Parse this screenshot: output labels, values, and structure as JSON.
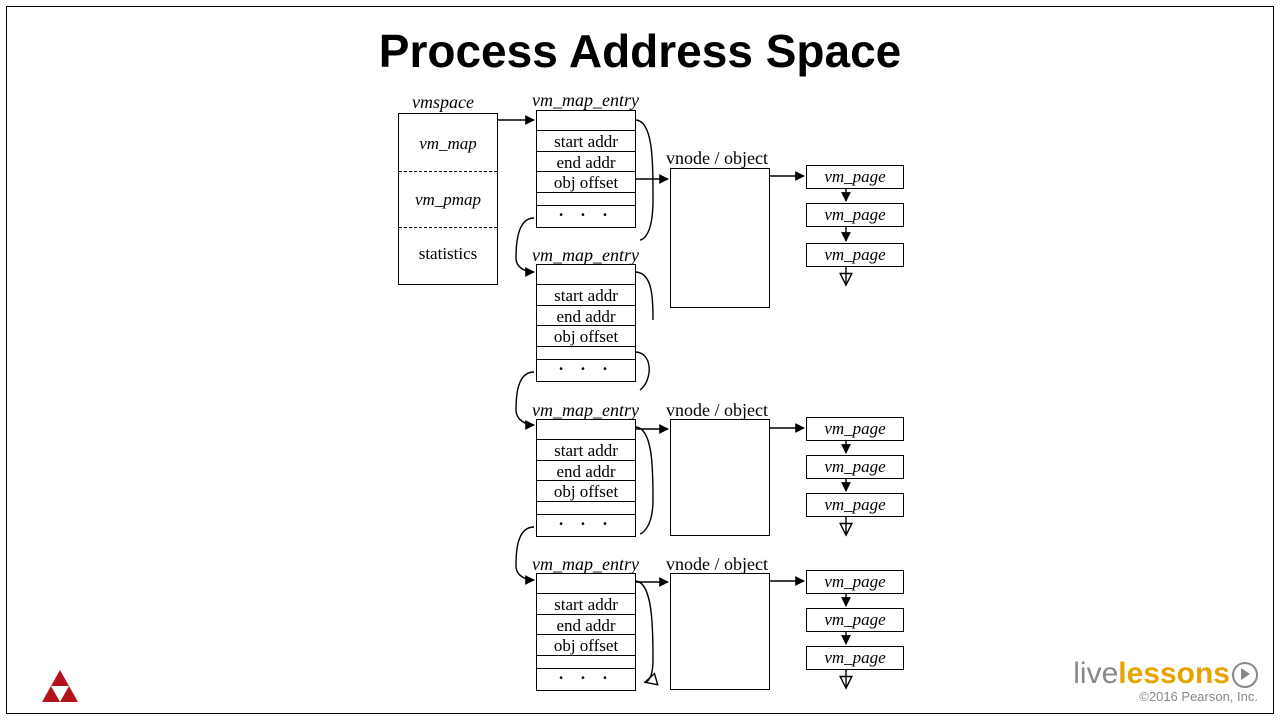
{
  "title": "Process Address Space",
  "vmspace": {
    "label": "vmspace",
    "fields": [
      "vm_map",
      "vm_pmap",
      "statistics"
    ]
  },
  "entry_label": "vm_map_entry",
  "entry_fields": [
    "start addr",
    "end addr",
    "obj offset"
  ],
  "ellipsis": "· · ·",
  "vnode_label": "vnode / object",
  "page_label": "vm_page",
  "footer": {
    "brand_a": "live",
    "brand_b": "lessons",
    "copyright": "©2016 Pearson, Inc."
  }
}
